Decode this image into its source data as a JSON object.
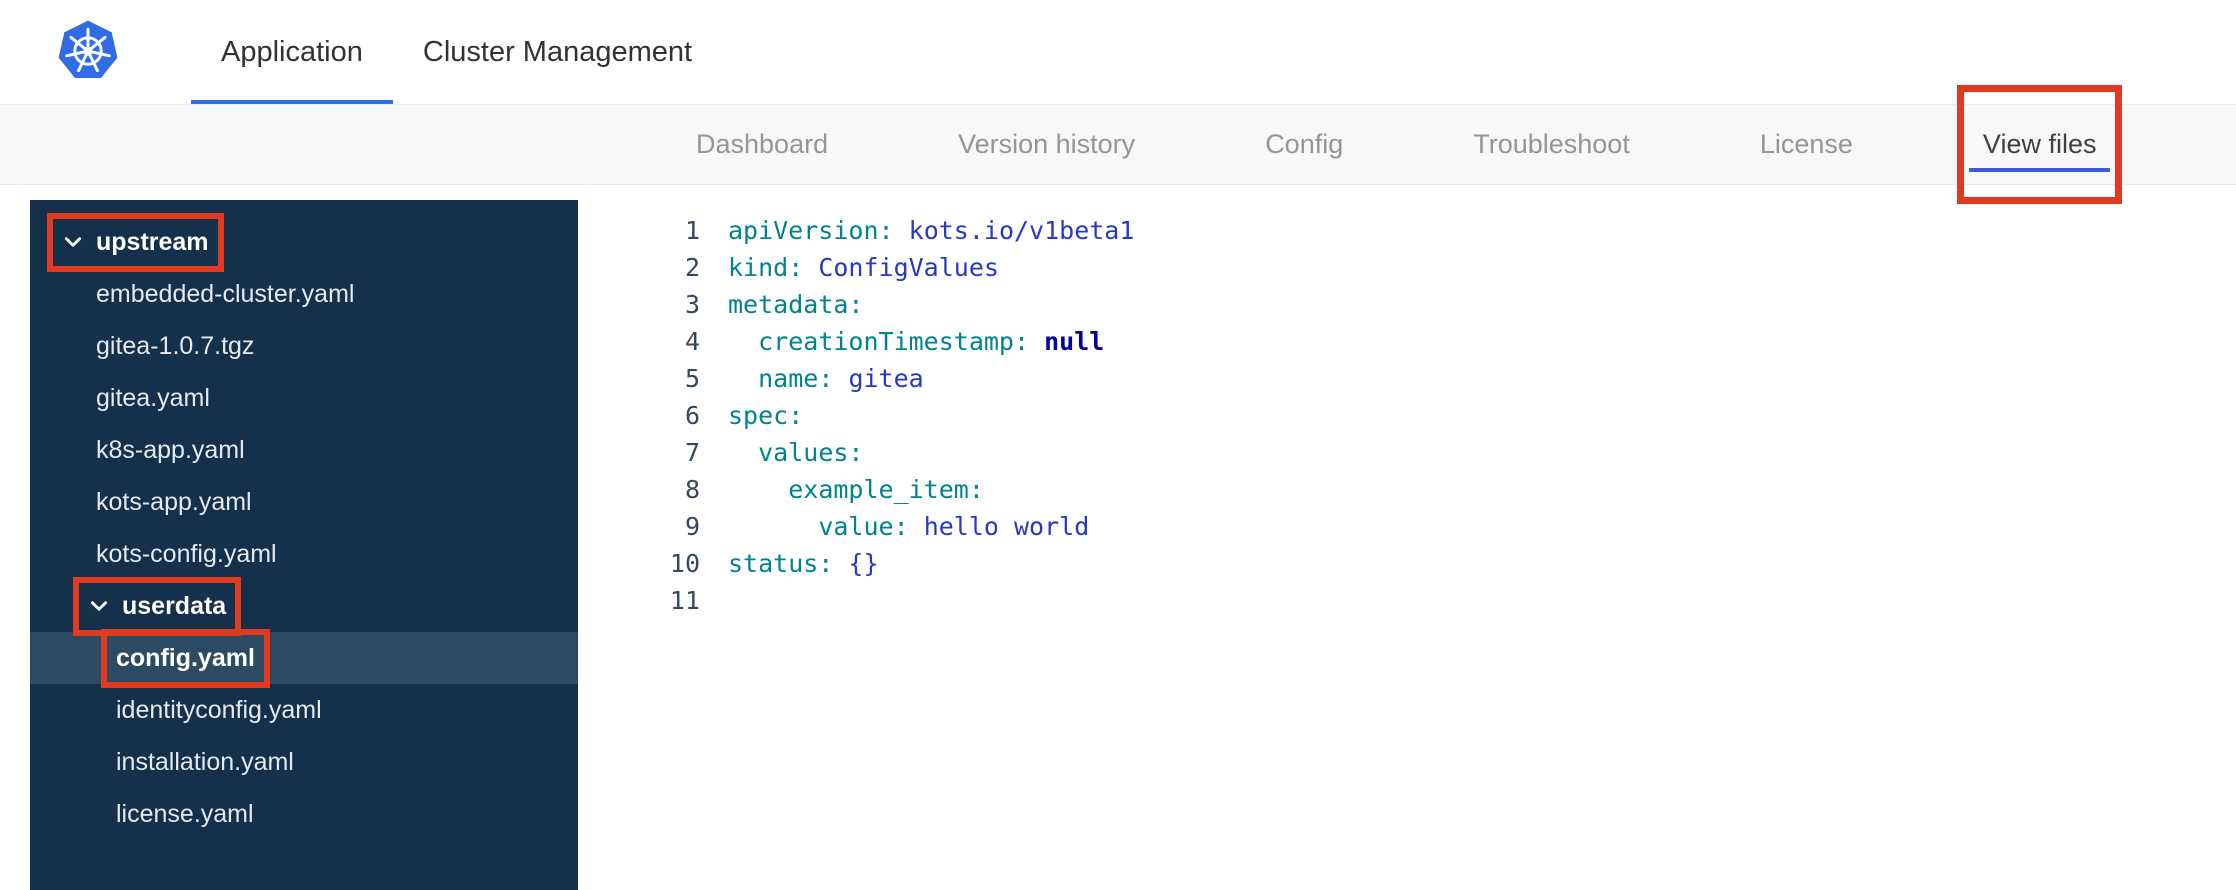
{
  "colors": {
    "accent_blue": "#326de6",
    "nav_underline_blue": "#3a5ce4",
    "annotation_red": "#e03a21",
    "sidebar_bg": "#15304a",
    "sidebar_selected_bg": "#2d4a63",
    "code_key": "#00838f",
    "code_value": "#2639c3",
    "code_null": "#0000a2",
    "line_number": "#34495e"
  },
  "header": {
    "logo_icon": "kubernetes-logo",
    "tabs": [
      {
        "label": "Application",
        "active": true
      },
      {
        "label": "Cluster Management",
        "active": false
      }
    ]
  },
  "nav": {
    "items": [
      {
        "label": "Dashboard",
        "active": false,
        "annotated": false
      },
      {
        "label": "Version history",
        "active": false,
        "annotated": false
      },
      {
        "label": "Config",
        "active": false,
        "annotated": false
      },
      {
        "label": "Troubleshoot",
        "active": false,
        "annotated": false
      },
      {
        "label": "License",
        "active": false,
        "annotated": false
      },
      {
        "label": "View files",
        "active": true,
        "annotated": true
      }
    ]
  },
  "file_tree": {
    "items": [
      {
        "type": "folder",
        "label": "upstream",
        "level": 0,
        "expanded": true,
        "selected": false,
        "annotated": true
      },
      {
        "type": "file",
        "label": "embedded-cluster.yaml",
        "level": 1,
        "selected": false,
        "annotated": false
      },
      {
        "type": "file",
        "label": "gitea-1.0.7.tgz",
        "level": 1,
        "selected": false,
        "annotated": false
      },
      {
        "type": "file",
        "label": "gitea.yaml",
        "level": 1,
        "selected": false,
        "annotated": false
      },
      {
        "type": "file",
        "label": "k8s-app.yaml",
        "level": 1,
        "selected": false,
        "annotated": false
      },
      {
        "type": "file",
        "label": "kots-app.yaml",
        "level": 1,
        "selected": false,
        "annotated": false
      },
      {
        "type": "file",
        "label": "kots-config.yaml",
        "level": 1,
        "selected": false,
        "annotated": false
      },
      {
        "type": "folder",
        "label": "userdata",
        "level": 1,
        "expanded": true,
        "selected": false,
        "annotated": true
      },
      {
        "type": "file",
        "label": "config.yaml",
        "level": 2,
        "selected": true,
        "annotated": true
      },
      {
        "type": "file",
        "label": "identityconfig.yaml",
        "level": 2,
        "selected": false,
        "annotated": false
      },
      {
        "type": "file",
        "label": "installation.yaml",
        "level": 2,
        "selected": false,
        "annotated": false
      },
      {
        "type": "file",
        "label": "license.yaml",
        "level": 2,
        "selected": false,
        "annotated": false
      }
    ]
  },
  "editor": {
    "language": "yaml",
    "lines": [
      {
        "number": 1,
        "tokens": [
          {
            "cls": "key",
            "text": "apiVersion:"
          },
          {
            "cls": "plain",
            "text": " "
          },
          {
            "cls": "value",
            "text": "kots.io/v1beta1"
          }
        ]
      },
      {
        "number": 2,
        "tokens": [
          {
            "cls": "key",
            "text": "kind:"
          },
          {
            "cls": "plain",
            "text": " "
          },
          {
            "cls": "value",
            "text": "ConfigValues"
          }
        ]
      },
      {
        "number": 3,
        "tokens": [
          {
            "cls": "key",
            "text": "metadata:"
          }
        ]
      },
      {
        "number": 4,
        "tokens": [
          {
            "cls": "plain",
            "text": "  "
          },
          {
            "cls": "key",
            "text": "creationTimestamp:"
          },
          {
            "cls": "plain",
            "text": " "
          },
          {
            "cls": "null",
            "text": "null"
          }
        ]
      },
      {
        "number": 5,
        "tokens": [
          {
            "cls": "plain",
            "text": "  "
          },
          {
            "cls": "key",
            "text": "name:"
          },
          {
            "cls": "plain",
            "text": " "
          },
          {
            "cls": "value",
            "text": "gitea"
          }
        ]
      },
      {
        "number": 6,
        "tokens": [
          {
            "cls": "key",
            "text": "spec:"
          }
        ]
      },
      {
        "number": 7,
        "tokens": [
          {
            "cls": "plain",
            "text": "  "
          },
          {
            "cls": "key",
            "text": "values:"
          }
        ]
      },
      {
        "number": 8,
        "tokens": [
          {
            "cls": "plain",
            "text": "    "
          },
          {
            "cls": "key",
            "text": "example_item:"
          }
        ]
      },
      {
        "number": 9,
        "tokens": [
          {
            "cls": "plain",
            "text": "      "
          },
          {
            "cls": "key",
            "text": "value:"
          },
          {
            "cls": "plain",
            "text": " "
          },
          {
            "cls": "value",
            "text": "hello world"
          }
        ]
      },
      {
        "number": 10,
        "tokens": [
          {
            "cls": "key",
            "text": "status:"
          },
          {
            "cls": "plain",
            "text": " "
          },
          {
            "cls": "value",
            "text": "{}"
          }
        ]
      },
      {
        "number": 11,
        "tokens": []
      }
    ]
  }
}
